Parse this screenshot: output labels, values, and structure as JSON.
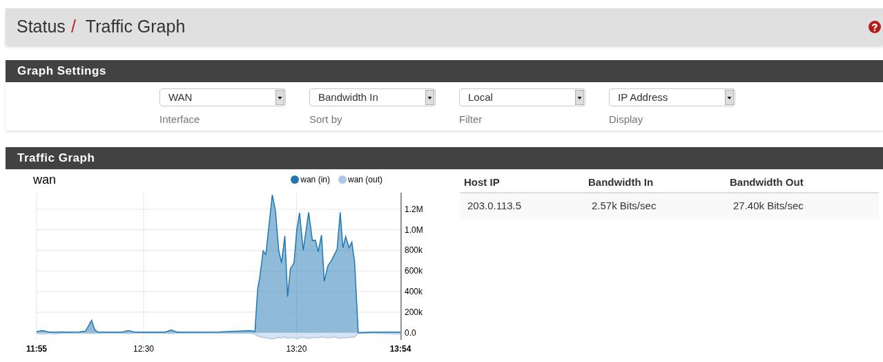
{
  "breadcrumb": {
    "section": "Status",
    "separator": "/",
    "page": "Traffic Graph"
  },
  "settings_panel": {
    "title": "Graph Settings",
    "fields": [
      {
        "value": "WAN",
        "label": "Interface"
      },
      {
        "value": "Bandwidth In",
        "label": "Sort by"
      },
      {
        "value": "Local",
        "label": "Filter"
      },
      {
        "value": "IP Address",
        "label": "Display"
      }
    ]
  },
  "graph_panel": {
    "title": "Traffic Graph",
    "chart": {
      "chart_data": {
        "type": "area",
        "title": "wan",
        "x": [
          715,
          717,
          719,
          721,
          723,
          725,
          729,
          731,
          733,
          734,
          735,
          743,
          745,
          747,
          757,
          759,
          761,
          775,
          785,
          786.4,
          787.3,
          788,
          789.1,
          790,
          792.1,
          793.1,
          794.2,
          795.1,
          796.2,
          797.1,
          798,
          799.2,
          800.1,
          801,
          802.2,
          804,
          805.2,
          806.2,
          807.1,
          808.2,
          809.1,
          810.3,
          811.5,
          812.6,
          813.3,
          814.3,
          815.2,
          816.1,
          817.2,
          818.1,
          819,
          820.2,
          825,
          834
        ],
        "series": [
          {
            "name": "wan (in)",
            "color": "#1f77b4",
            "values": [
              10000,
              20000,
              5000,
              5000,
              8000,
              5000,
              8000,
              15000,
              120000,
              30000,
              5000,
              5000,
              20000,
              5000,
              5000,
              25000,
              5000,
              8000,
              20000,
              10000,
              420000,
              540000,
              795000,
              760000,
              1340000,
              1190000,
              800000,
              680000,
              940000,
              350000,
              620000,
              680000,
              1000000,
              1165000,
              800000,
              1170000,
              895000,
              900000,
              785000,
              950000,
              500000,
              650000,
              705000,
              770000,
              810000,
              1170000,
              825000,
              935000,
              825000,
              880000,
              690000,
              0,
              5000,
              5000
            ]
          },
          {
            "name": "wan (out)",
            "color": "#aec7e8",
            "values": [
              -5000,
              -15000,
              -5000,
              -12000,
              -5000,
              -5000,
              -5000,
              -5000,
              -8000,
              -5000,
              -5000,
              -5000,
              -8000,
              -5000,
              -5000,
              -8000,
              -5000,
              -5000,
              -5000,
              -15000,
              -30000,
              -40000,
              -45000,
              -50000,
              -60000,
              -55000,
              -45000,
              -50000,
              -40000,
              -55000,
              -50000,
              -45000,
              -60000,
              -50000,
              -45000,
              -55000,
              -50000,
              -45000,
              -50000,
              -40000,
              -45000,
              -50000,
              -45000,
              -40000,
              -50000,
              -55000,
              -45000,
              -50000,
              -45000,
              -45000,
              -40000,
              -5000,
              -5000,
              -12000
            ]
          }
        ],
        "grid": true,
        "xlim": [
          715,
          834
        ],
        "ylim": [
          -70000,
          1360000
        ],
        "xticks": [
          {
            "value": 715,
            "label": "11:55"
          },
          {
            "value": 750,
            "label": "12:30"
          },
          {
            "value": 800,
            "label": "13:20"
          },
          {
            "value": 834,
            "label": "13:54"
          }
        ],
        "yticks": [
          {
            "value": 0,
            "label": "0.0"
          },
          {
            "value": 200000,
            "label": "200k"
          },
          {
            "value": 400000,
            "label": "400k"
          },
          {
            "value": 600000,
            "label": "600k"
          },
          {
            "value": 800000,
            "label": "800k"
          },
          {
            "value": 1000000,
            "label": "1.0M"
          },
          {
            "value": 1200000,
            "label": "1.2M"
          }
        ]
      }
    },
    "table": {
      "columns": [
        "Host IP",
        "Bandwidth In",
        "Bandwidth Out"
      ],
      "rows": [
        [
          "203.0.113.5",
          "2.57k Bits/sec",
          "27.40k Bits/sec"
        ]
      ]
    }
  }
}
